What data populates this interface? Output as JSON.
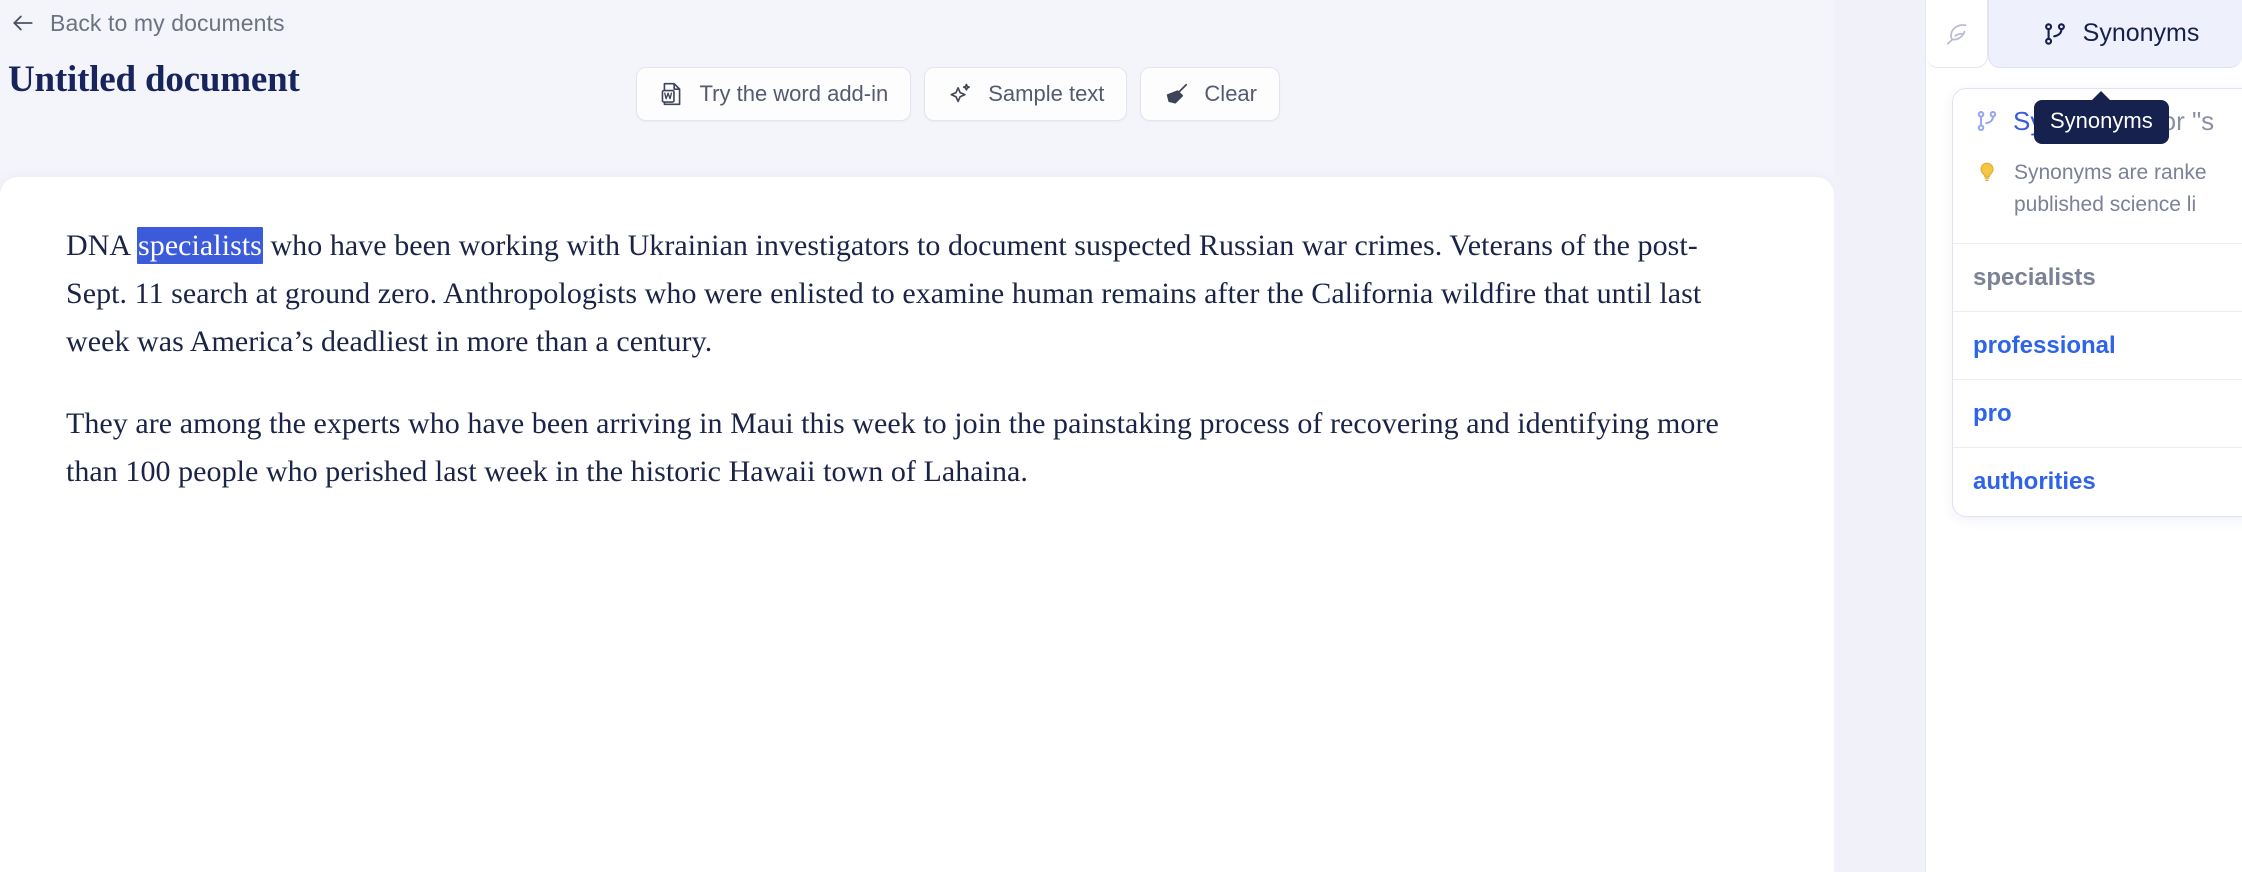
{
  "header": {
    "back_label": "Back to my documents",
    "back_icon": "arrow-left-icon",
    "title": "Untitled document"
  },
  "toolbar": {
    "buttons": [
      {
        "label": "Try the word add-in",
        "icon": "word-document-icon"
      },
      {
        "label": "Sample text",
        "icon": "sparkle-star-icon"
      },
      {
        "label": "Clear",
        "icon": "broom-icon"
      }
    ]
  },
  "document": {
    "paragraphs": [
      {
        "before": "DNA ",
        "selected": "specialists",
        "after": " who have been working with Ukrainian investigators to document suspected Russian war crimes. Veterans of the post-Sept. 11 search at ground zero. Anthropologists who were enlisted to examine human remains after the California wildfire that until last week was America’s deadliest in more than a century."
      },
      {
        "text": "They are among the experts who have been arriving in Maui this week to join the painstaking process of recovering and identifying more than 100 people who perished last week in the historic Hawaii town of Lahaina."
      }
    ]
  },
  "right_panel": {
    "tabs": [
      {
        "id": "paraphrase",
        "label": "",
        "icon": "feather-quill-icon",
        "active": false
      },
      {
        "id": "synonyms",
        "label": "Synonyms",
        "icon": "git-branch-icon",
        "active": true
      }
    ],
    "tooltip": "Synonyms",
    "synonyms_card": {
      "header_icon": "git-branch-icon",
      "header_title": "Synonyms",
      "header_rest": "for \"s",
      "hint_icon": "lightbulb-icon",
      "hint_line_1": "Synonyms are ranke",
      "hint_line_2": "published science li",
      "query_word": "specialists",
      "options": [
        "professional",
        "pro",
        "authorities"
      ]
    }
  },
  "colors": {
    "page_background": "#f4f4fb",
    "accent_blue": "#3b5bdb",
    "option_blue": "#2f63e8",
    "title_navy": "#17255c",
    "selection_blue": "#3b5bdb",
    "tooltip_navy": "#16214d"
  }
}
